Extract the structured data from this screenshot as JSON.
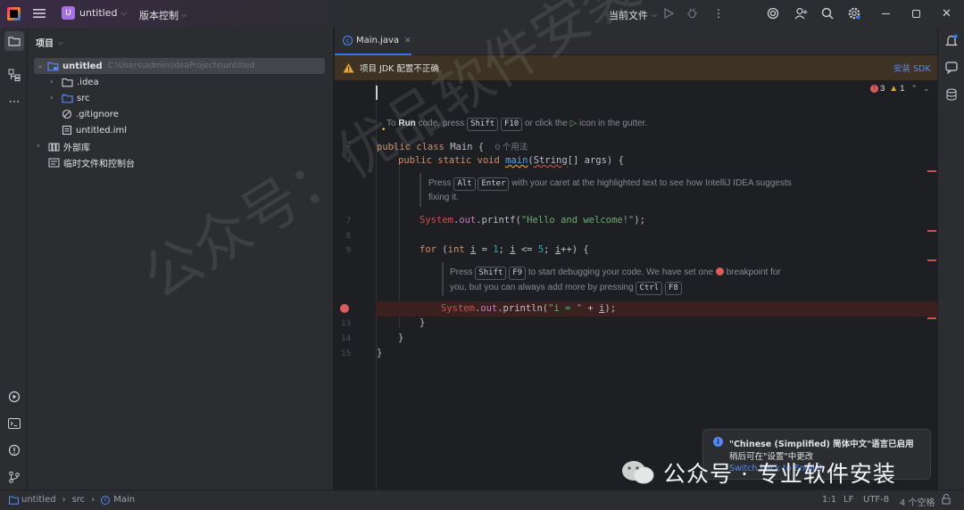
{
  "titlebar": {
    "project_initial": "U",
    "project_name": "untitled",
    "vcs_label": "版本控制",
    "run_config": "当前文件"
  },
  "project_panel": {
    "title": "项目",
    "tree": [
      {
        "label": "untitled",
        "path": "C:\\Users\\admin\\IdeaProjects\\untitled"
      },
      {
        "label": ".idea"
      },
      {
        "label": "src"
      },
      {
        "label": ".gitignore"
      },
      {
        "label": "untitled.iml"
      },
      {
        "label": "外部库"
      },
      {
        "label": "临时文件和控制台"
      }
    ]
  },
  "editor": {
    "tab_label": "Main.java",
    "banner_text": "项目 JDK 配置不正确",
    "banner_action": "安装 SDK",
    "inspections": {
      "errors": "3",
      "warnings": "1"
    },
    "hint_run": {
      "pre": "To",
      "run": "Run",
      "mid": "code, press",
      "key1": "Shift",
      "key2": "F10",
      "post1": "or click the",
      "post2": "icon in the gutter."
    },
    "usage_hint": "0 个用法",
    "hint_alt": {
      "pre": "Press",
      "key1": "Alt",
      "key2": "Enter",
      "post": "with your caret at the highlighted text to see how IntelliJ IDEA suggests",
      "post2": "fixing it."
    },
    "hint_debug": {
      "pre": "Press",
      "key1": "Shift",
      "key2": "F9",
      "post": "to start debugging your code. We have set one",
      "post_b": "breakpoint for",
      "line2": "you, but you can always add more by pressing",
      "key3": "Ctrl",
      "key4": "F8"
    },
    "line_numbers": [
      "3",
      "4",
      "7",
      "8",
      "9",
      "13",
      "14",
      "15"
    ]
  },
  "notification": {
    "title": "\"Chinese (Simplified) 简体中文\"语言已启用",
    "body": "稍后可在\"设置\"中更改",
    "link": "Switch back to English"
  },
  "watermark": {
    "brand": "公众号 · 专业软件安装",
    "diagonal": "公众号：优品软件安装"
  },
  "statusbar": {
    "crumbs": [
      "untitled",
      "src",
      "Main"
    ],
    "position": "1:1",
    "line_sep": "LF",
    "encoding": "UTF-8",
    "indent": "4 个空格"
  },
  "colors": {
    "accent": "#3574f0",
    "project_badge": "#a571e6",
    "error": "#db5c5c",
    "warning_banner": "#3d3223"
  }
}
